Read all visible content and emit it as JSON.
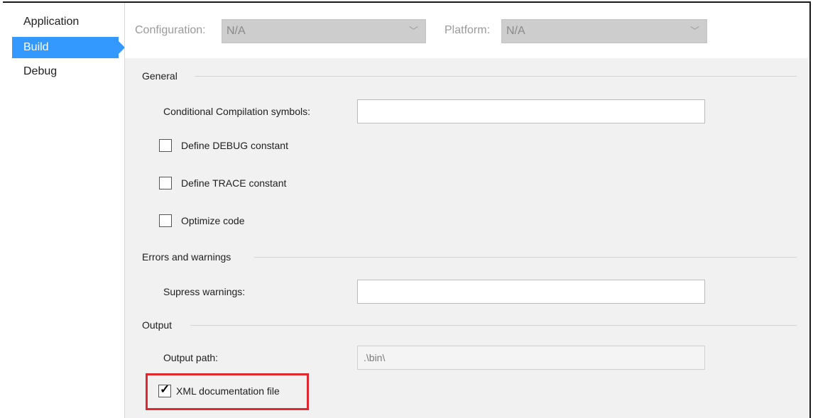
{
  "sidebar": {
    "items": [
      {
        "label": "Application"
      },
      {
        "label": "Build"
      },
      {
        "label": "Debug"
      }
    ]
  },
  "topbar": {
    "configuration_label": "Configuration:",
    "configuration_value": "N/A",
    "platform_label": "Platform:",
    "platform_value": "N/A"
  },
  "general": {
    "title": "General",
    "conditional_label": "Conditional Compilation symbols:",
    "conditional_value": "",
    "define_debug": {
      "label": "Define DEBUG constant",
      "checked": false
    },
    "define_trace": {
      "label": "Define TRACE constant",
      "checked": false
    },
    "optimize": {
      "label": "Optimize code",
      "checked": false
    }
  },
  "errors": {
    "title": "Errors and warnings",
    "suppress_label": "Supress warnings:",
    "suppress_value": ""
  },
  "output": {
    "title": "Output",
    "path_label": "Output path:",
    "path_value": ".\\bin\\",
    "xml_doc": {
      "label": "XML documentation file",
      "checked": true
    }
  },
  "colors": {
    "accent": "#3399ff",
    "highlight_border": "#e0262f",
    "panel_bg": "#f1f1f1"
  }
}
